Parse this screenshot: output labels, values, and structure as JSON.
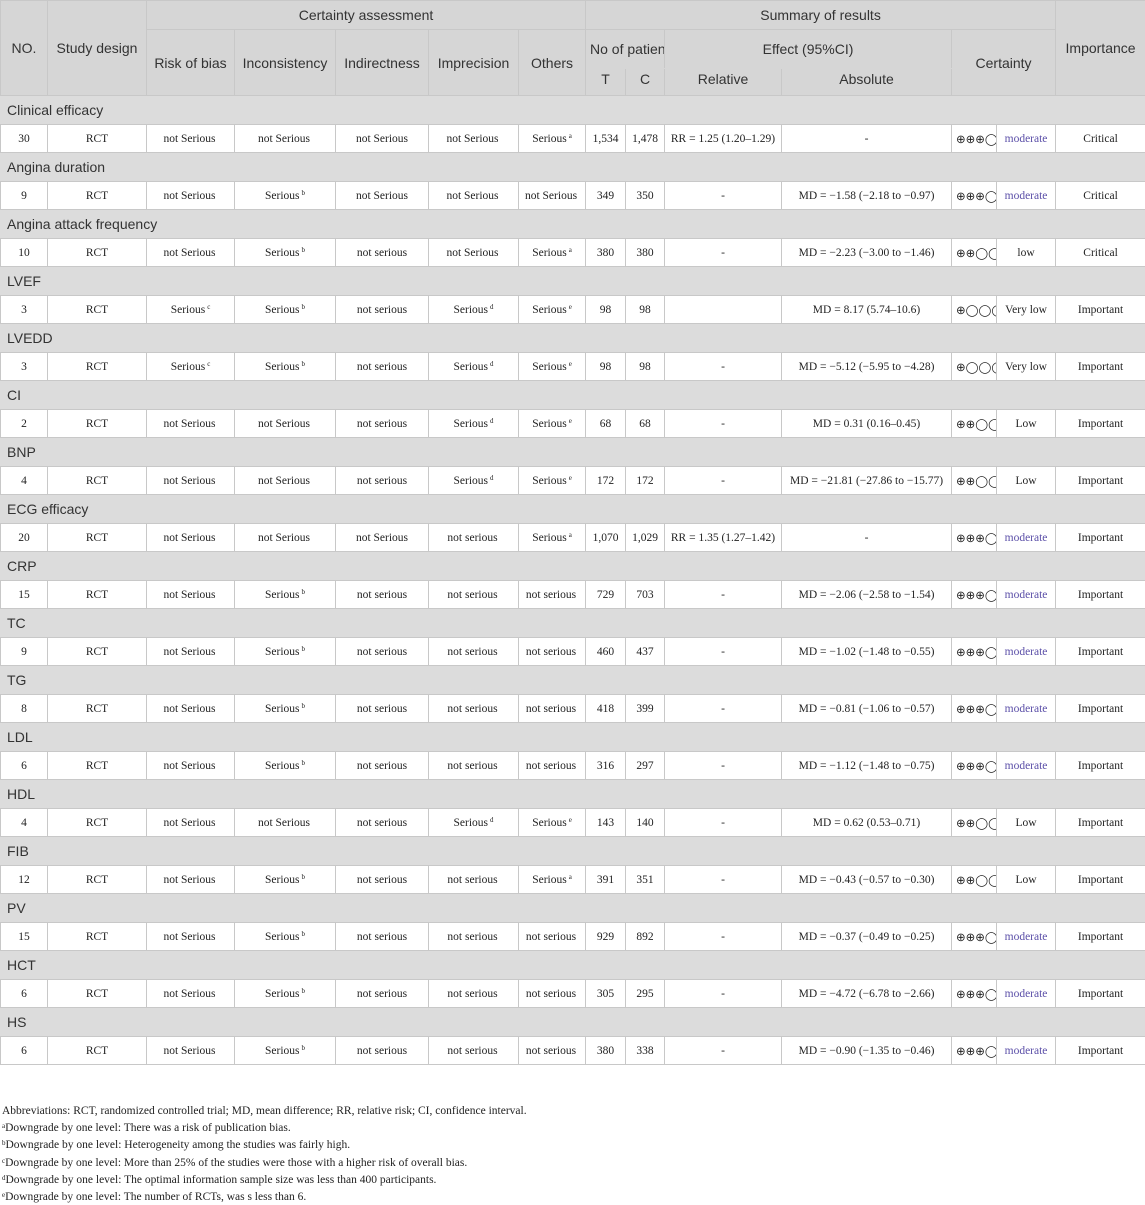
{
  "header": {
    "no": "NO.",
    "design": "Study design",
    "certainty_assessment": "Certainty assessment",
    "summary": "Summary of results",
    "importance": "Importance",
    "risk_of_bias": "Risk of bias",
    "inconsistency": "Inconsistency",
    "indirectness": "Indirectness",
    "imprecision": "Imprecision",
    "others": "Others",
    "no_of_patients": "No of patients",
    "effect": "Effect (95%CI)",
    "certainty": "Certainty",
    "t": "T",
    "c": "C",
    "relative": "Relative",
    "absolute": "Absolute"
  },
  "outcomes": [
    {
      "name": "Clinical efficacy",
      "row": {
        "n": "30",
        "design": "RCT",
        "rob": "not Serious",
        "rob_sup": "",
        "inc": "not Serious",
        "inc_sup": "",
        "ind": "not Serious",
        "imp": "not Serious",
        "imp_sup": "",
        "oth": "Serious",
        "oth_sup": "a",
        "t": "1,534",
        "c": "1,478",
        "rel": "RR = 1.25 (1.20–1.29)",
        "abs": "-",
        "sym": "⊕⊕⊕◯",
        "level": "moderate",
        "imp_level": "Critical"
      }
    },
    {
      "name": "Angina duration",
      "row": {
        "n": "9",
        "design": "RCT",
        "rob": "not Serious",
        "rob_sup": "",
        "inc": "Serious",
        "inc_sup": "b",
        "ind": "not Serious",
        "imp": "not Serious",
        "imp_sup": "",
        "oth": "not Serious",
        "oth_sup": "",
        "t": "349",
        "c": "350",
        "rel": "-",
        "abs": "MD = −1.58 (−2.18 to −0.97)",
        "sym": "⊕⊕⊕◯",
        "level": "moderate",
        "imp_level": "Critical"
      }
    },
    {
      "name": "Angina attack frequency",
      "row": {
        "n": "10",
        "design": "RCT",
        "rob": "not Serious",
        "rob_sup": "",
        "inc": "Serious",
        "inc_sup": "b",
        "ind": "not serious",
        "imp": "not Serious",
        "imp_sup": "",
        "oth": "Serious",
        "oth_sup": "a",
        "t": "380",
        "c": "380",
        "rel": "-",
        "abs": "MD = −2.23 (−3.00 to −1.46)",
        "sym": "⊕⊕◯◯",
        "level": "low",
        "imp_level": "Critical"
      }
    },
    {
      "name": "LVEF",
      "row": {
        "n": "3",
        "design": "RCT",
        "rob": "Serious",
        "rob_sup": "c",
        "inc": "Serious",
        "inc_sup": "b",
        "ind": "not serious",
        "imp": "Serious",
        "imp_sup": "d",
        "oth": "Serious",
        "oth_sup": "e",
        "t": "98",
        "c": "98",
        "rel": "",
        "abs": "MD = 8.17 (5.74–10.6)",
        "sym": "⊕◯◯◯",
        "level": "Very low",
        "imp_level": "Important"
      }
    },
    {
      "name": "LVEDD",
      "row": {
        "n": "3",
        "design": "RCT",
        "rob": "Serious",
        "rob_sup": "c",
        "inc": "Serious",
        "inc_sup": "b",
        "ind": "not serious",
        "imp": "Serious",
        "imp_sup": "d",
        "oth": "Serious",
        "oth_sup": "e",
        "t": "98",
        "c": "98",
        "rel": "-",
        "abs": "MD = −5.12 (−5.95 to −4.28)",
        "sym": "⊕◯◯◯",
        "level": "Very low",
        "imp_level": "Important"
      }
    },
    {
      "name": "CI",
      "row": {
        "n": "2",
        "design": "RCT",
        "rob": "not Serious",
        "rob_sup": "",
        "inc": "not Serious",
        "inc_sup": "",
        "ind": "not serious",
        "imp": "Serious",
        "imp_sup": "d",
        "oth": "Serious",
        "oth_sup": "e",
        "t": "68",
        "c": "68",
        "rel": "-",
        "abs": "MD = 0.31 (0.16–0.45)",
        "sym": "⊕⊕◯◯",
        "level": "Low",
        "imp_level": "Important"
      }
    },
    {
      "name": "BNP",
      "row": {
        "n": "4",
        "design": "RCT",
        "rob": "not Serious",
        "rob_sup": "",
        "inc": "not Serious",
        "inc_sup": "",
        "ind": "not serious",
        "imp": "Serious",
        "imp_sup": "d",
        "oth": "Serious",
        "oth_sup": "e",
        "t": "172",
        "c": "172",
        "rel": "-",
        "abs": "MD = −21.81 (−27.86 to −15.77)",
        "sym": "⊕⊕◯◯",
        "level": "Low",
        "imp_level": "Important"
      }
    },
    {
      "name": "ECG efficacy",
      "row": {
        "n": "20",
        "design": "RCT",
        "rob": "not Serious",
        "rob_sup": "",
        "inc": "not Serious",
        "inc_sup": "",
        "ind": "not Serious",
        "imp": "not serious",
        "imp_sup": "",
        "oth": "Serious",
        "oth_sup": "a",
        "t": "1,070",
        "c": "1,029",
        "rel": "RR = 1.35 (1.27–1.42)",
        "abs": "-",
        "sym": "⊕⊕⊕◯",
        "level": "moderate",
        "imp_level": "Important"
      }
    },
    {
      "name": "CRP",
      "row": {
        "n": "15",
        "design": "RCT",
        "rob": "not Serious",
        "rob_sup": "",
        "inc": "Serious",
        "inc_sup": "b",
        "ind": "not serious",
        "imp": "not serious",
        "imp_sup": "",
        "oth": "not serious",
        "oth_sup": "",
        "t": "729",
        "c": "703",
        "rel": "-",
        "abs": "MD = −2.06 (−2.58 to −1.54)",
        "sym": "⊕⊕⊕◯",
        "level": "moderate",
        "imp_level": "Important"
      }
    },
    {
      "name": "TC",
      "row": {
        "n": "9",
        "design": "RCT",
        "rob": "not Serious",
        "rob_sup": "",
        "inc": "Serious",
        "inc_sup": "b",
        "ind": "not serious",
        "imp": "not serious",
        "imp_sup": "",
        "oth": "not serious",
        "oth_sup": "",
        "t": "460",
        "c": "437",
        "rel": "-",
        "abs": "MD = −1.02 (−1.48 to −0.55)",
        "sym": "⊕⊕⊕◯",
        "level": "moderate",
        "imp_level": "Important"
      }
    },
    {
      "name": "TG",
      "row": {
        "n": "8",
        "design": "RCT",
        "rob": "not Serious",
        "rob_sup": "",
        "inc": "Serious",
        "inc_sup": "b",
        "ind": "not serious",
        "imp": "not serious",
        "imp_sup": "",
        "oth": "not serious",
        "oth_sup": "",
        "t": "418",
        "c": "399",
        "rel": "-",
        "abs": "MD = −0.81 (−1.06 to −0.57)",
        "sym": "⊕⊕⊕◯",
        "level": "moderate",
        "imp_level": "Important"
      }
    },
    {
      "name": "LDL",
      "row": {
        "n": "6",
        "design": "RCT",
        "rob": "not Serious",
        "rob_sup": "",
        "inc": "Serious",
        "inc_sup": "b",
        "ind": "not serious",
        "imp": "not serious",
        "imp_sup": "",
        "oth": "not serious",
        "oth_sup": "",
        "t": "316",
        "c": "297",
        "rel": "-",
        "abs": "MD = −1.12 (−1.48 to −0.75)",
        "sym": "⊕⊕⊕◯",
        "level": "moderate",
        "imp_level": "Important"
      }
    },
    {
      "name": "HDL",
      "row": {
        "n": "4",
        "design": "RCT",
        "rob": "not Serious",
        "rob_sup": "",
        "inc": "not Serious",
        "inc_sup": "",
        "ind": "not serious",
        "imp": "Serious",
        "imp_sup": "d",
        "oth": "Serious",
        "oth_sup": "e",
        "t": "143",
        "c": "140",
        "rel": "-",
        "abs": "MD = 0.62 (0.53–0.71)",
        "sym": "⊕⊕◯◯",
        "level": "Low",
        "imp_level": "Important"
      }
    },
    {
      "name": "FIB",
      "row": {
        "n": "12",
        "design": "RCT",
        "rob": "not Serious",
        "rob_sup": "",
        "inc": "Serious",
        "inc_sup": "b",
        "ind": "not serious",
        "imp": "not serious",
        "imp_sup": "",
        "oth": "Serious",
        "oth_sup": "a",
        "t": "391",
        "c": "351",
        "rel": "-",
        "abs": "MD = −0.43 (−0.57 to −0.30)",
        "sym": "⊕⊕◯◯",
        "level": "Low",
        "imp_level": "Important"
      }
    },
    {
      "name": "PV",
      "row": {
        "n": "15",
        "design": "RCT",
        "rob": "not Serious",
        "rob_sup": "",
        "inc": "Serious",
        "inc_sup": "b",
        "ind": "not serious",
        "imp": "not serious",
        "imp_sup": "",
        "oth": "not serious",
        "oth_sup": "",
        "t": "929",
        "c": "892",
        "rel": "-",
        "abs": "MD = −0.37 (−0.49 to −0.25)",
        "sym": "⊕⊕⊕◯",
        "level": "moderate",
        "imp_level": "Important"
      }
    },
    {
      "name": "HCT",
      "row": {
        "n": "6",
        "design": "RCT",
        "rob": "not Serious",
        "rob_sup": "",
        "inc": "Serious",
        "inc_sup": "b",
        "ind": "not serious",
        "imp": "not serious",
        "imp_sup": "",
        "oth": "not serious",
        "oth_sup": "",
        "t": "305",
        "c": "295",
        "rel": "-",
        "abs": "MD = −4.72 (−6.78 to −2.66)",
        "sym": "⊕⊕⊕◯",
        "level": "moderate",
        "imp_level": "Important"
      }
    },
    {
      "name": "HS",
      "row": {
        "n": "6",
        "design": "RCT",
        "rob": "not Serious",
        "rob_sup": "",
        "inc": "Serious",
        "inc_sup": "b",
        "ind": "not serious",
        "imp": "not serious",
        "imp_sup": "",
        "oth": "not serious",
        "oth_sup": "",
        "t": "380",
        "c": "338",
        "rel": "-",
        "abs": "MD = −0.90 (−1.35 to −0.46)",
        "sym": "⊕⊕⊕◯",
        "level": "moderate",
        "imp_level": "Important"
      }
    }
  ],
  "footnotes": {
    "abbreviations": "Abbreviations: RCT, randomized controlled trial; MD, mean difference; RR, relative risk; CI, confidence interval.",
    "items": [
      {
        "mark": "a",
        "text": "Downgrade by one level: There was a risk of publication bias."
      },
      {
        "mark": "b",
        "text": "Downgrade by one level: Heterogeneity among the studies was fairly high."
      },
      {
        "mark": "c",
        "text": "Downgrade by one level: More than 25% of the studies were those with a higher risk of overall bias."
      },
      {
        "mark": "d",
        "text": "Downgrade by one level: The optimal information sample size was less than 400 participants."
      },
      {
        "mark": "e",
        "text": "Downgrade by one level: The number of RCTs, was s less than 6."
      }
    ]
  },
  "colors": {
    "header_bg": "#d6d6d6",
    "section_bg": "#dcdcdc",
    "moderate_text": "#5b4fa8"
  }
}
